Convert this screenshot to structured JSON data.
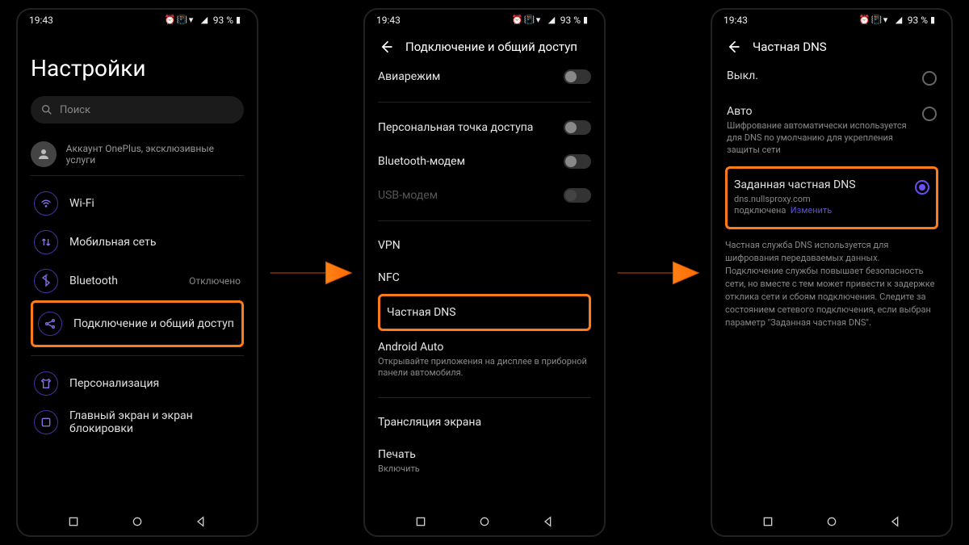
{
  "statusbar": {
    "time": "19:43",
    "battery": "93 %"
  },
  "screen1": {
    "title": "Настройки",
    "search_placeholder": "Поиск",
    "account": "Аккаунт OnePlus, эксклюзивные услуги",
    "items": {
      "wifi": "Wi-Fi",
      "mobile": "Мобильная сеть",
      "bluetooth": "Bluetooth",
      "bluetooth_status": "Отключено",
      "connectivity": "Подключение и общий доступ",
      "personalization": "Персонализация",
      "homescreen": "Главный экран и экран блокировки"
    }
  },
  "screen2": {
    "header": "Подключение и общий доступ",
    "airplane": "Авиарежим",
    "hotspot": "Персональная точка доступа",
    "bt_tether": "Bluetooth-модем",
    "usb_tether": "USB-модем",
    "vpn": "VPN",
    "nfc": "NFC",
    "private_dns": "Частная DNS",
    "android_auto": "Android Auto",
    "android_auto_sub": "Открывайте приложения на дисплее в приборной панели автомобиля.",
    "cast": "Трансляция экрана",
    "print": "Печать",
    "print_sub": "Включить"
  },
  "screen3": {
    "header": "Частная DNS",
    "off": "Выкл.",
    "auto": "Авто",
    "auto_sub": "Шифрование автоматически используется для DNS по умолчанию для укрепления защиты сети",
    "designated": "Заданная частная DNS",
    "designated_sub_host": "dns.nullsproxy.com подключена",
    "designated_edit": "Изменить",
    "description": "Частная служба DNS используется для шифрования передаваемых данных. Подключение службы повышает безопасность сети, но вместе с тем может привести к задержке отклика сети и сбоям подключения. Следите за состоянием сетевого подключения, если выбран параметр \"Заданная частная DNS\"."
  },
  "colors": {
    "highlight": "#ff7a18",
    "accent": "#6a4ff5"
  }
}
